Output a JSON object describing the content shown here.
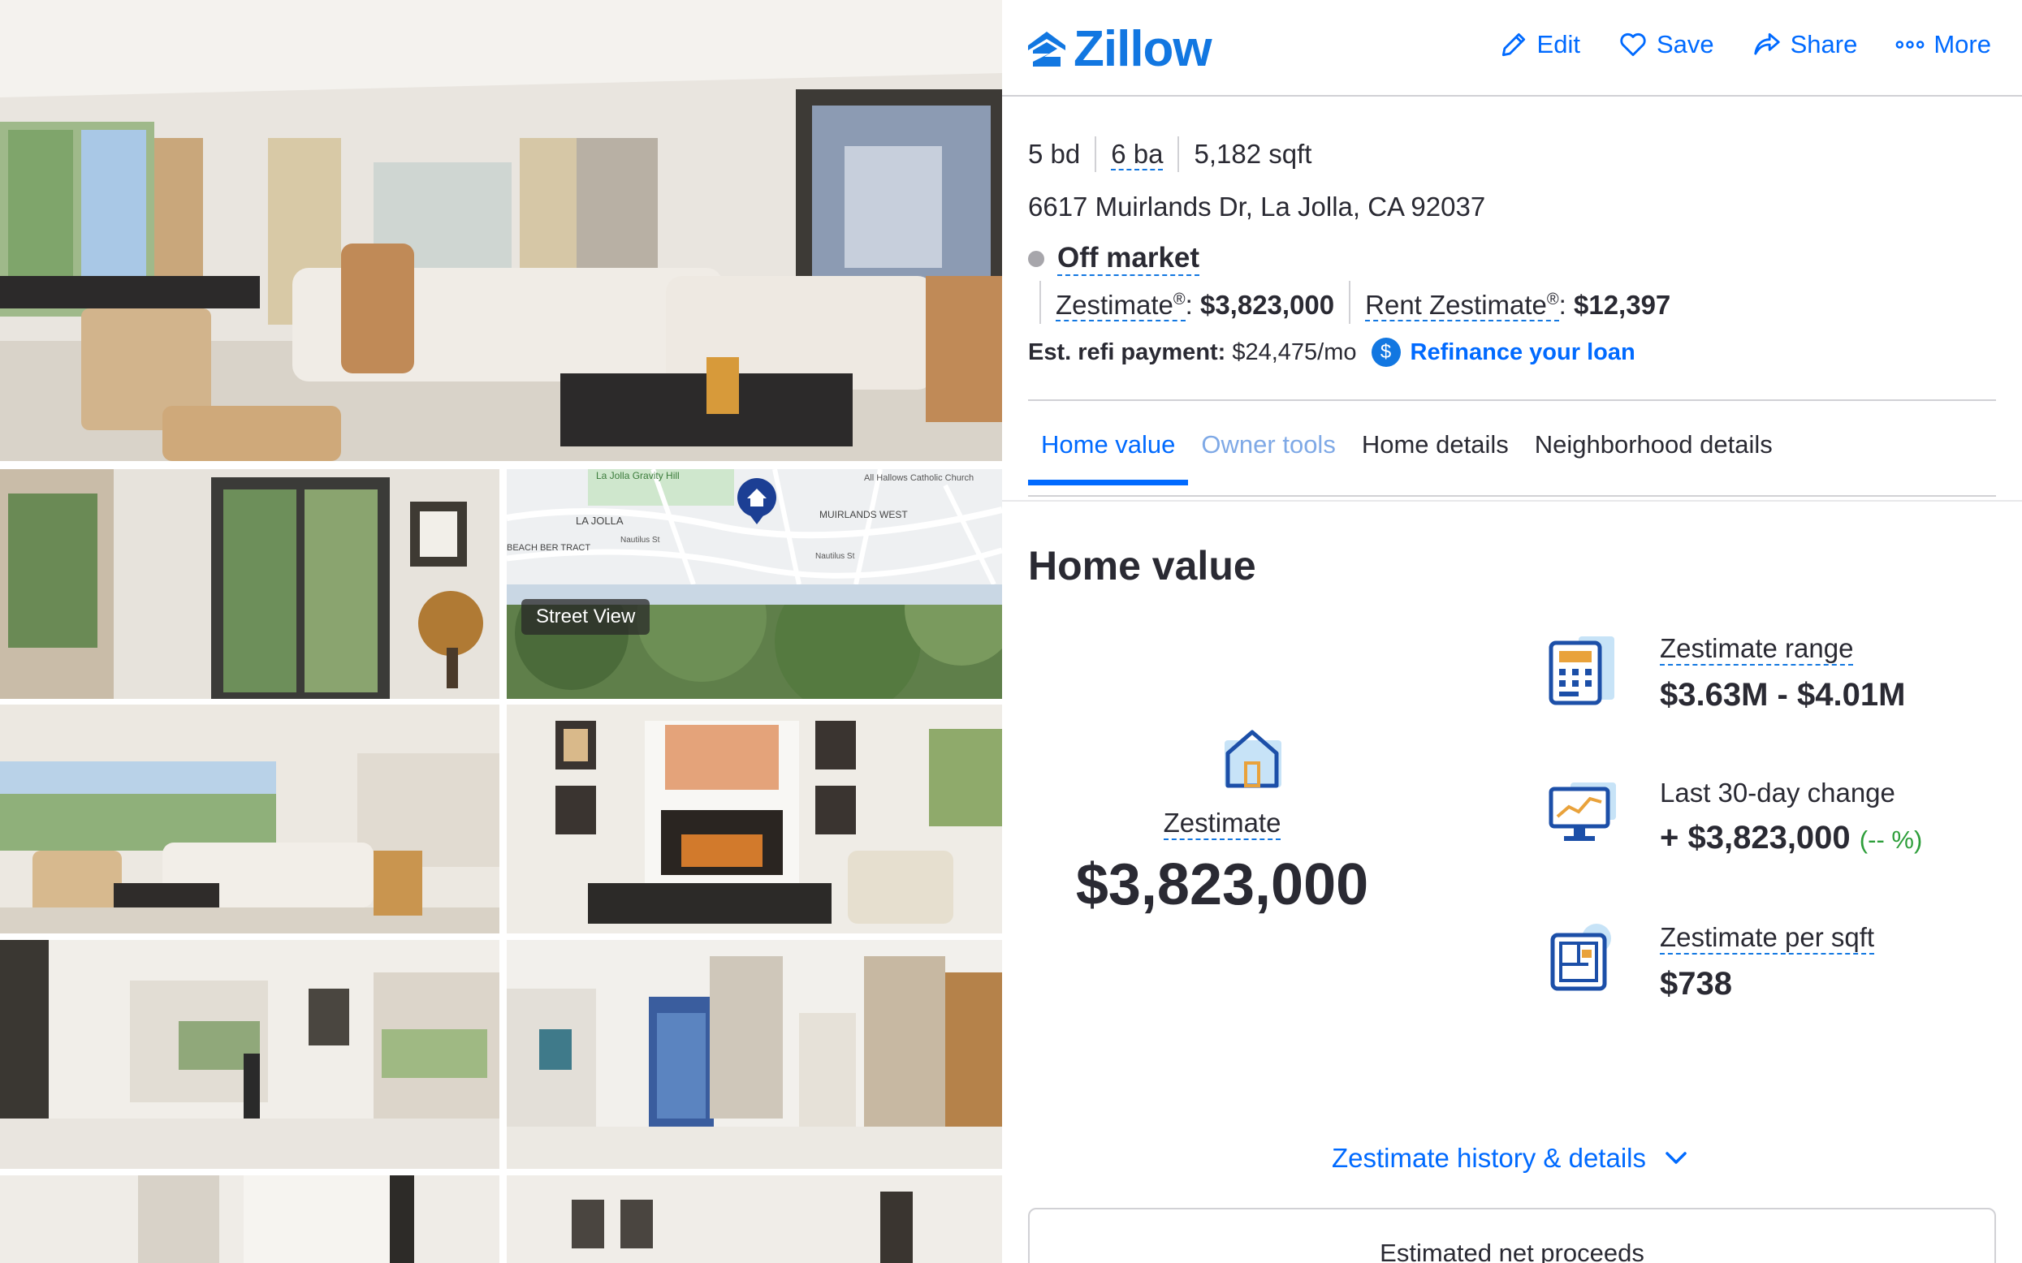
{
  "brand": {
    "name": "Zillow",
    "color": "#1277e1"
  },
  "header": {
    "actions": [
      {
        "label": "Edit",
        "icon": "pencil-icon"
      },
      {
        "label": "Save",
        "icon": "heart-icon"
      },
      {
        "label": "Share",
        "icon": "share-icon"
      },
      {
        "label": "More",
        "icon": "more-dots-icon"
      }
    ]
  },
  "gallery": {
    "street_view_label": "Street View"
  },
  "property": {
    "beds": "5 bd",
    "baths": "6 ba",
    "sqft": "5,182 sqft",
    "address": "6617 Muirlands Dr, La Jolla, CA 92037",
    "status": "Off market",
    "zestimate_label": "Zestimate",
    "zestimate_value": "$3,823,000",
    "rent_label": "Rent Zestimate",
    "rent_value": "$12,397",
    "refi_label": "Est. refi payment:",
    "refi_value": "$24,475/mo",
    "refi_link": "Refinance your loan"
  },
  "tabs": [
    {
      "label": "Home value",
      "state": "active"
    },
    {
      "label": "Owner tools",
      "state": "muted"
    },
    {
      "label": "Home details",
      "state": "normal"
    },
    {
      "label": "Neighborhood details",
      "state": "normal"
    }
  ],
  "home_value": {
    "title": "Home value",
    "zestimate_label": "Zestimate",
    "zestimate_value": "$3,823,000",
    "range_label": "Zestimate range",
    "range_value": "$3.63M - $4.01M",
    "change_label": "Last 30-day change",
    "change_value": "+ $3,823,000",
    "change_pct": "(-- %)",
    "per_sqft_label": "Zestimate per sqft",
    "per_sqft_value": "$738",
    "history_link": "Zestimate history & details",
    "proceeds_label": "Estimated net proceeds"
  },
  "map": {
    "labels": [
      "La Jolla Gravity Hill",
      "All Hallows Catholic Church",
      "LA JOLLA",
      "MUIRLANDS WEST",
      "BEACH BER TRACT",
      "Nautilus St",
      "Nautilus St"
    ]
  }
}
